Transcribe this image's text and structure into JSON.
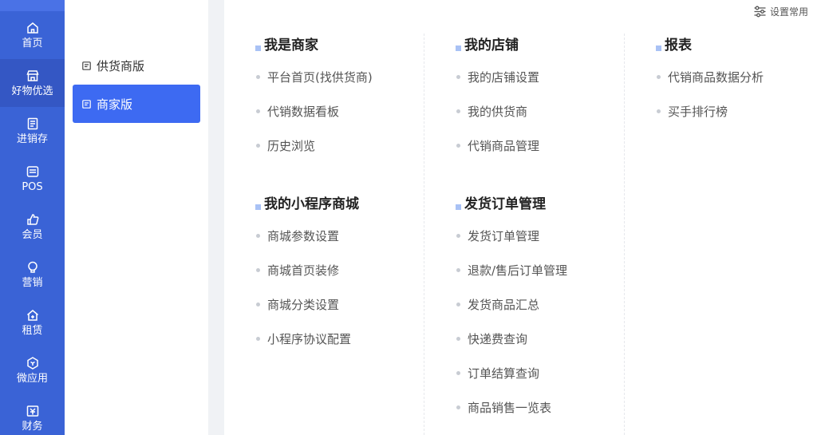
{
  "rail": {
    "items": [
      {
        "label": "首页",
        "icon": "home-icon"
      },
      {
        "label": "好物优选",
        "icon": "store-icon"
      },
      {
        "label": "进销存",
        "icon": "inventory-icon"
      },
      {
        "label": "POS",
        "icon": "pos-icon"
      },
      {
        "label": "会员",
        "icon": "member-icon"
      },
      {
        "label": "营销",
        "icon": "marketing-icon"
      },
      {
        "label": "租赁",
        "icon": "lease-icon"
      },
      {
        "label": "微应用",
        "icon": "micro-app-icon"
      },
      {
        "label": "财务",
        "icon": "finance-icon"
      }
    ],
    "active": "好物优选"
  },
  "submenu": {
    "items": [
      {
        "label": "供货商版"
      },
      {
        "label": "商家版"
      }
    ],
    "active": "商家版"
  },
  "settings": {
    "label": "设置常用"
  },
  "groups": [
    {
      "title": "我是商家",
      "links": [
        "平台首页(找供货商)",
        "代销数据看板",
        "历史浏览"
      ]
    },
    {
      "title": "我的小程序商城",
      "links": [
        "商城参数设置",
        "商城首页装修",
        "商城分类设置",
        "小程序协议配置"
      ]
    },
    {
      "title": "我的店铺",
      "links": [
        "我的店铺设置",
        "我的供货商",
        "代销商品管理"
      ]
    },
    {
      "title": "发货订单管理",
      "links": [
        "发货订单管理",
        "退款/售后订单管理",
        "发货商品汇总",
        "快递费查询",
        "订单结算查询",
        "商品销售一览表"
      ]
    },
    {
      "title": "报表",
      "links": [
        "代销商品数据分析",
        "买手排行榜"
      ]
    }
  ],
  "colors": {
    "rail": "#3a63d6",
    "active_sub": "#3d6af2",
    "accent_square": "#a9c2f5"
  }
}
